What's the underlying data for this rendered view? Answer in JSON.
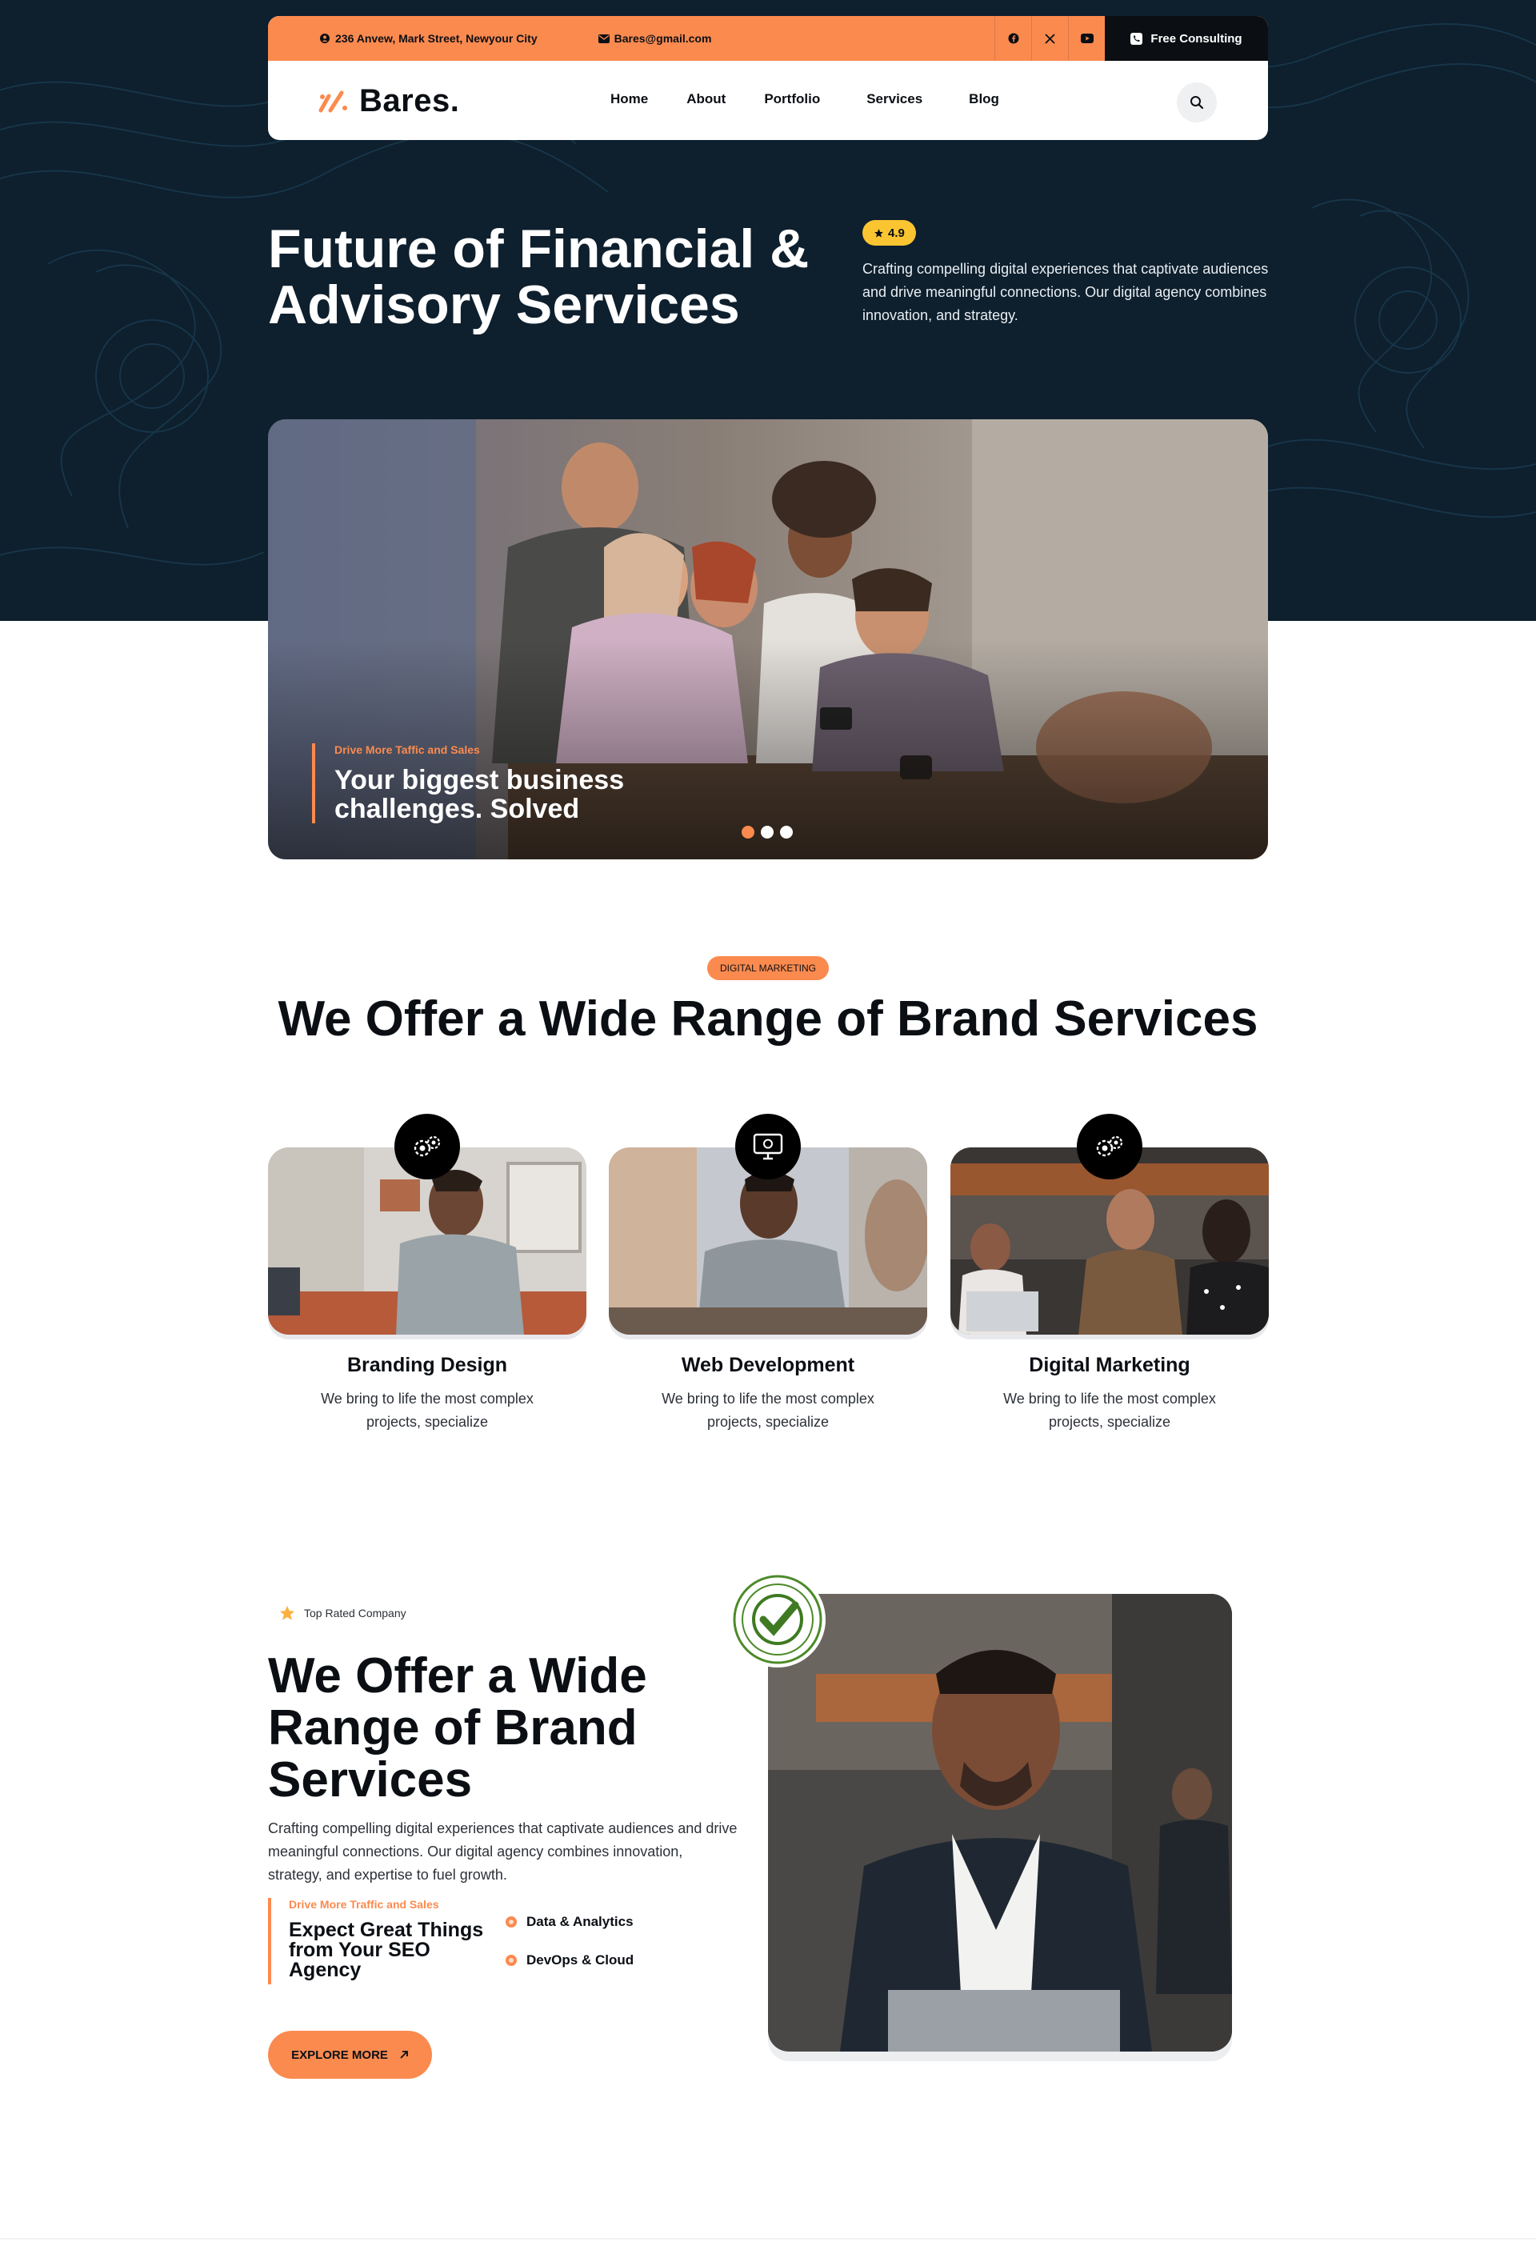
{
  "topbar": {
    "address": "236 Anvew, Mark Street, Newyour City",
    "email": "Bares@gmail.com",
    "social_icons": [
      "facebook-icon",
      "x-icon",
      "youtube-icon"
    ],
    "cta_label": "Free Consulting"
  },
  "brand": {
    "name": "Bares.",
    "accent": "#fb8a4f",
    "dark": "#0e1f2d"
  },
  "nav": {
    "items": [
      "Home",
      "About",
      "Portfolio",
      "Services",
      "Blog"
    ]
  },
  "hero": {
    "title": "Future of Financial & Advisory Services",
    "rating": "4.9",
    "description": "Crafting compelling digital experiences that captivate audiences and drive meaningful connections. Our digital agency combines innovation, and strategy.",
    "slide": {
      "kicker": "Drive More Taffic and Sales",
      "title": "Your biggest business challenges. Solved",
      "total_slides": 3,
      "active_slide": 1
    }
  },
  "services": {
    "tag": "DIGITAL MARKETING",
    "title": "We Offer a Wide Range of Brand Services",
    "cards": [
      {
        "icon": "gears-icon",
        "title": "Branding Design",
        "description": "We bring to life the most complex projects, specialize"
      },
      {
        "icon": "monitor-icon",
        "title": "Web Development",
        "description": "We bring to life the most complex projects, specialize"
      },
      {
        "icon": "gears-icon",
        "title": "Digital Marketing",
        "description": "We bring to life the most complex projects, specialize"
      }
    ]
  },
  "about": {
    "tag": "Top Rated Company",
    "title": "We Offer a Wide Range of Brand Services",
    "description": "Crafting compelling digital experiences that captivate audiences and drive meaningful connections. Our digital agency combines innovation, strategy, and expertise to fuel growth.",
    "kicker": "Drive More Traffic and Sales",
    "quote_title": "Expect Great Things from Your SEO Agency",
    "features": [
      "Data & Analytics",
      "DevOps & Cloud"
    ],
    "cta_label": "EXPLORE MORE"
  }
}
